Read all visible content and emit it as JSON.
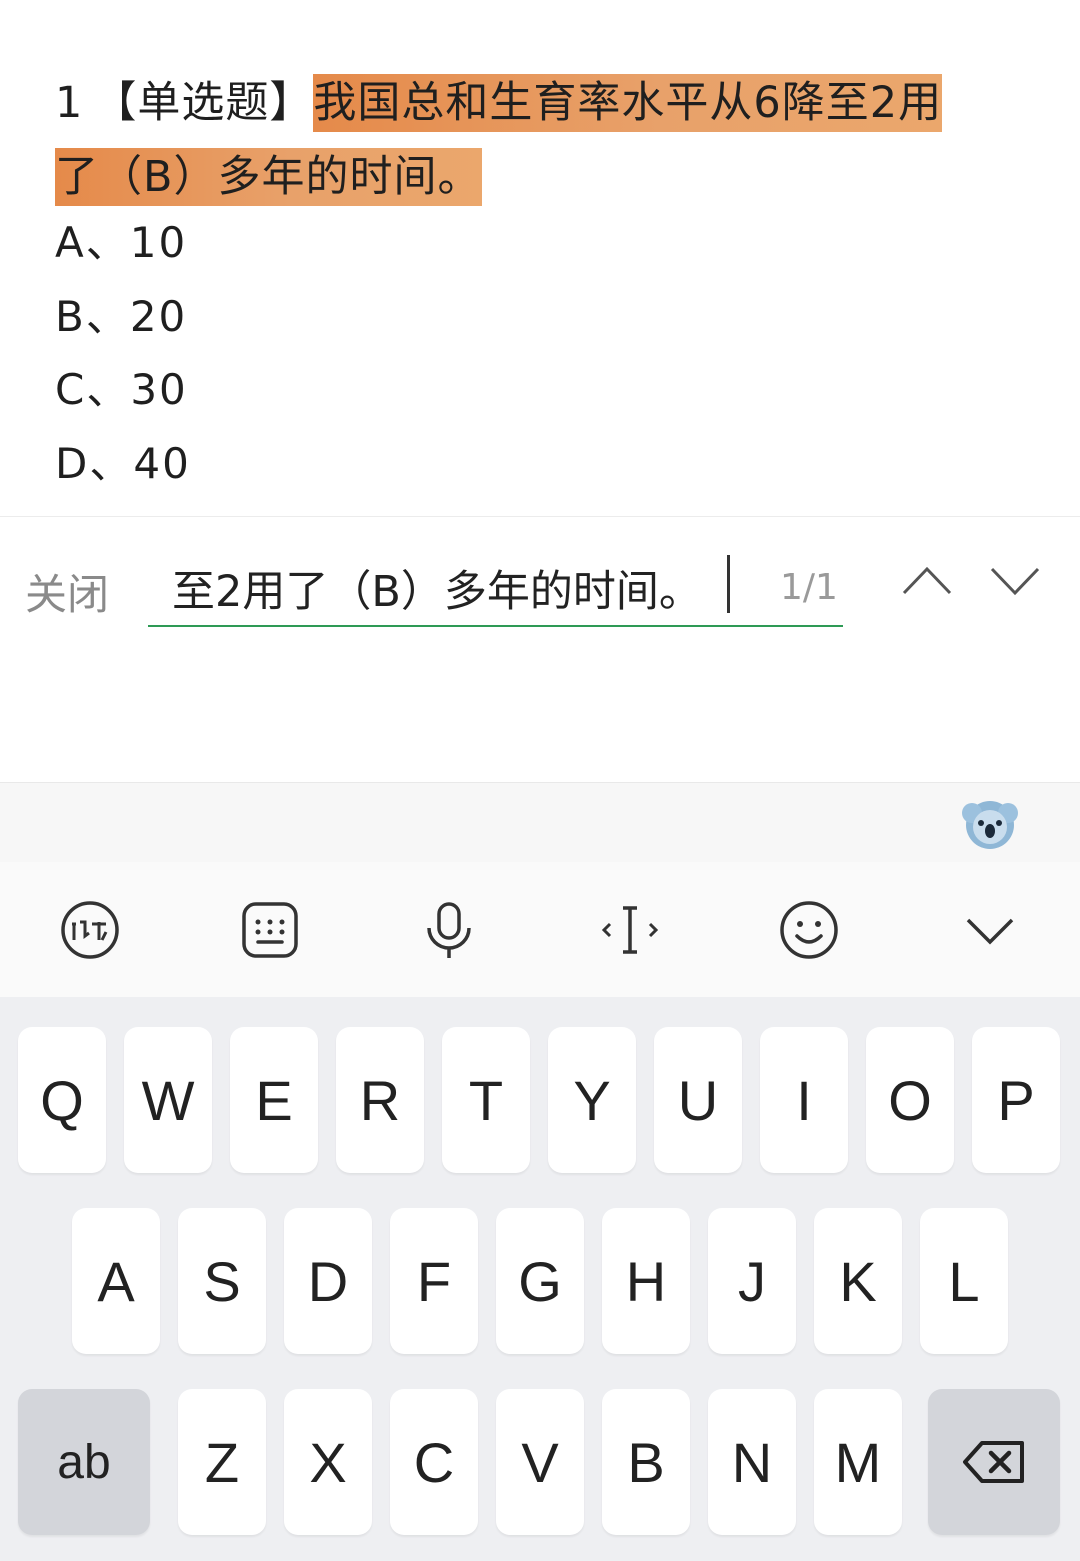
{
  "question": {
    "number": "1",
    "type": "【单选题】",
    "text_line1": "我国总和生育率水平从6降至2用",
    "text_line2": "了（B）多年的时间。"
  },
  "options": [
    {
      "label": "A、10"
    },
    {
      "label": "B、20"
    },
    {
      "label": "C、30"
    },
    {
      "label": "D、40"
    }
  ],
  "findbar": {
    "close_label": "关闭",
    "search_value": "至2用了（B）多年的时间。",
    "match_count": "1/1",
    "prev_icon": "chevron-up-icon",
    "next_icon": "chevron-down-icon"
  },
  "suggestion_bar": {
    "mascot_icon": "koala-mascot-icon"
  },
  "keyboard_toolbar": {
    "items": [
      "ifly-logo-icon",
      "keyboard-icon",
      "microphone-icon",
      "cursor-move-icon",
      "emoji-icon",
      "collapse-icon"
    ]
  },
  "keyboard": {
    "row1": [
      "Q",
      "W",
      "E",
      "R",
      "T",
      "Y",
      "U",
      "I",
      "O",
      "P"
    ],
    "row2": [
      "A",
      "S",
      "D",
      "F",
      "G",
      "H",
      "J",
      "K",
      "L"
    ],
    "row3": [
      "Z",
      "X",
      "C",
      "V",
      "B",
      "N",
      "M"
    ],
    "mode_key": "ab",
    "backspace_icon": "backspace-icon"
  },
  "colors": {
    "highlight": "#e8985a",
    "accent_underline": "#2e9a55",
    "keyboard_bg": "#eeeff2",
    "function_key": "#d3d5da"
  }
}
